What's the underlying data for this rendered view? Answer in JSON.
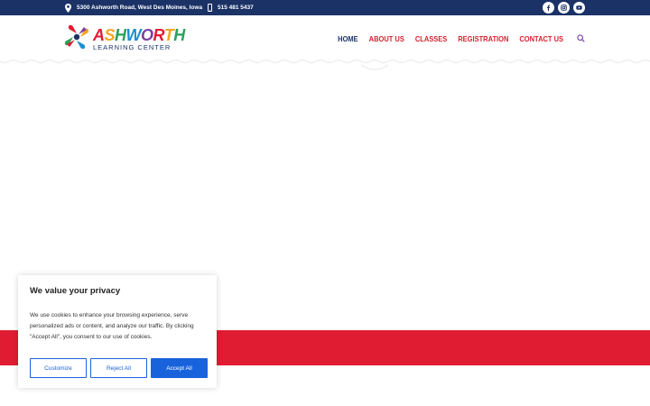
{
  "topbar": {
    "address": "5300 Ashworth Road, West Des Moines, Iowa",
    "phone": "515 481 5437",
    "social_icons": [
      "facebook-icon",
      "instagram-icon",
      "youtube-icon"
    ]
  },
  "logo": {
    "title": "ASHWORTH",
    "subtitle": "LEARNING CENTER"
  },
  "nav": {
    "items": [
      {
        "label": "HOME"
      },
      {
        "label": "ABOUT US"
      },
      {
        "label": "CLASSES"
      },
      {
        "label": "REGISTRATION"
      },
      {
        "label": "CONTACT US"
      }
    ],
    "active_index": 0
  },
  "cookie": {
    "title": "We value your privacy",
    "body": "We use cookies to enhance your browsing experience, serve personalized ads or content, and analyze our traffic. By clicking \"Accept All\", you consent to our use of cookies.",
    "customize": "Customize",
    "reject": "Reject All",
    "accept": "Accept All"
  },
  "colors": {
    "navy": "#1b3266",
    "red": "#e01c33",
    "button_blue": "#1863dc"
  }
}
